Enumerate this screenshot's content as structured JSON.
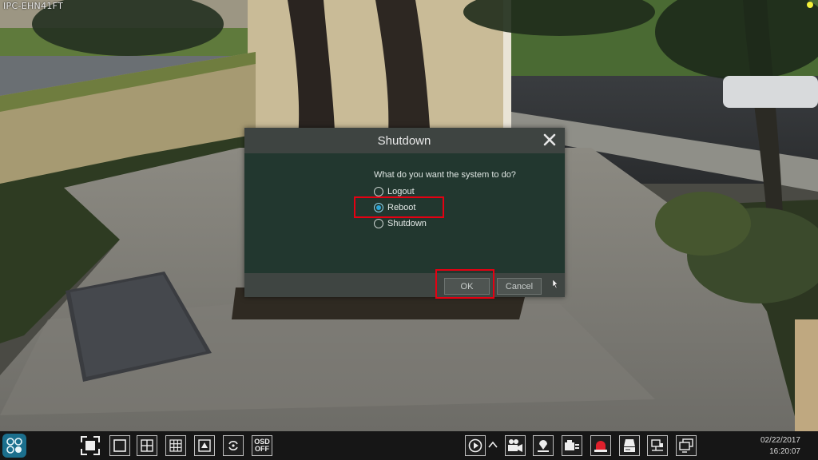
{
  "camera": {
    "title": "IPC-EHN41FT"
  },
  "dialog": {
    "title": "Shutdown",
    "question": "What do you want the system to do?",
    "options": [
      {
        "label": "Logout",
        "selected": false
      },
      {
        "label": "Reboot",
        "selected": true
      },
      {
        "label": "Shutdown",
        "selected": false
      }
    ],
    "ok_label": "OK",
    "cancel_label": "Cancel"
  },
  "taskbar": {
    "osd_line1": "OSD",
    "osd_line2": "OFF",
    "date": "02/22/2017",
    "time": "16:20:07",
    "icons": [
      "start-menu-icon",
      "full-screen-icon",
      "single-view-icon",
      "quad-view-icon",
      "nine-view-icon",
      "sequence-view-icon",
      "rotate-icon",
      "osd-toggle-icon",
      "playback-icon",
      "expand-icon",
      "manual-record-icon",
      "ptz-icon",
      "snapshot-icon",
      "alarm-icon",
      "disk-icon",
      "network-icon",
      "display-icon"
    ]
  },
  "colors": {
    "highlight": "#e50012",
    "dialog_body": "#22372f",
    "dialog_header": "#3e4441",
    "radio_selected": "#2da7d8",
    "menu_button": "#1b6f8d",
    "alarm": "#e0202c"
  }
}
